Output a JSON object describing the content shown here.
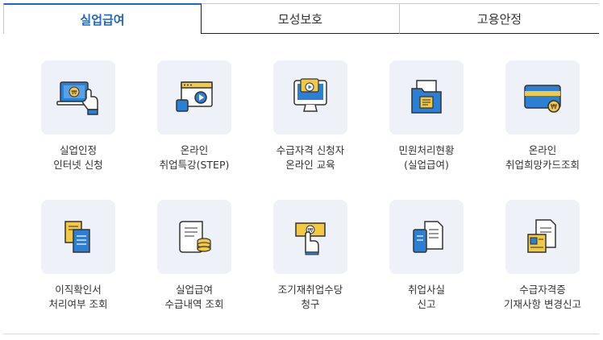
{
  "tabs": [
    {
      "label": "실업급여",
      "active": true
    },
    {
      "label": "모성보호",
      "active": false
    },
    {
      "label": "고용안정",
      "active": false
    }
  ],
  "items": [
    {
      "line1": "실업인정",
      "line2": "인터넷 신청",
      "icon": "laptop-hand-icon"
    },
    {
      "line1": "온라인",
      "line2": "취업특강(STEP)",
      "icon": "video-lecture-icon"
    },
    {
      "line1": "수급자격 신청자",
      "line2": "온라인 교육",
      "icon": "monitor-play-icon"
    },
    {
      "line1": "민원처리현황",
      "line2": "(실업급여)",
      "icon": "folder-document-icon"
    },
    {
      "line1": "온라인",
      "line2": "취업희망카드조회",
      "icon": "card-won-icon"
    },
    {
      "line1": "이직확인서",
      "line2": "처리여부 조회",
      "icon": "documents-icon"
    },
    {
      "line1": "실업급여",
      "line2": "수급내역 조회",
      "icon": "scroll-coins-icon"
    },
    {
      "line1": "조기재취업수당",
      "line2": "청구",
      "icon": "hand-money-icon"
    },
    {
      "line1": "취업사실",
      "line2": "신고",
      "icon": "phone-document-icon"
    },
    {
      "line1": "수급자격증",
      "line2": "기재사항 변경신고",
      "icon": "id-document-icon"
    }
  ],
  "colors": {
    "accent": "#1e66c7",
    "icon_bg": "#eef1f7",
    "icon_blue": "#2b7fd4",
    "icon_yellow": "#f3c944"
  }
}
